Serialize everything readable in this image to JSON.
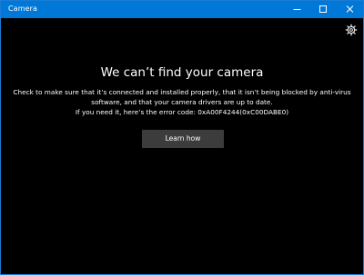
{
  "window": {
    "title": "Camera",
    "accent_color": "#0078d7",
    "background_color": "#000000",
    "caption_buttons": [
      {
        "name": "minimize-icon"
      },
      {
        "name": "maximize-icon"
      },
      {
        "name": "close-icon"
      }
    ]
  },
  "toolbar": {
    "settings_icon": "gear-icon"
  },
  "error": {
    "heading": "We can’t find your camera",
    "line1": "Check to make sure that it’s connected and installed properly, that it isn’t being blocked by anti-virus",
    "line2": "software, and that your camera drivers are up to date.",
    "line3": "If you need it, here’s the error code: 0xA00F4244(0xC00DABE0)",
    "button_label": "Learn how",
    "button_color": "#3c3c3c"
  }
}
